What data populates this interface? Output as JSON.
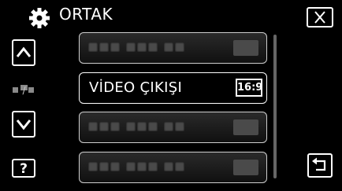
{
  "header": {
    "title": "ORTAK",
    "icon": "gear-icon"
  },
  "nav": {
    "up_icon": "chevron-up-icon",
    "down_icon": "chevron-down-icon",
    "help_label": "?",
    "page_indicator": "/"
  },
  "menu": {
    "selected_label": "VİDEO ÇIKIŞI",
    "selected_value": "16:9"
  },
  "controls": {
    "close_icon": "close-icon",
    "back_icon": "back-icon"
  }
}
